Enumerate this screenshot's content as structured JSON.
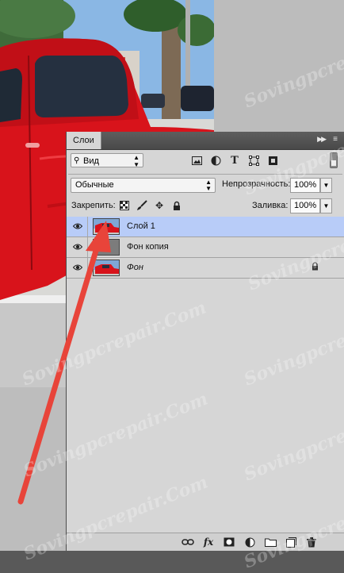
{
  "panel": {
    "tab_label": "Слои",
    "collapse_icon": "double-chevron-right-icon",
    "menu_icon": "panel-menu-icon"
  },
  "filter": {
    "kind_label": "Вид",
    "icons": [
      "image-filter-icon",
      "adjustment-filter-icon",
      "type-filter-icon",
      "shape-filter-icon",
      "smart-object-filter-icon"
    ]
  },
  "blend": {
    "mode": "Обычные",
    "opacity_label": "Непрозрачность:",
    "opacity_value": "100%"
  },
  "lock": {
    "label": "Закрепить:",
    "icons": [
      "lock-transparent-pixels-icon",
      "lock-image-pixels-icon",
      "lock-position-icon",
      "lock-all-icon"
    ],
    "fill_label": "Заливка:",
    "fill_value": "100%"
  },
  "layers": [
    {
      "name": "Слой 1",
      "active": true,
      "italic": false,
      "thumbnail": "car-photo",
      "locked": false
    },
    {
      "name": "Фон копия",
      "active": false,
      "italic": false,
      "thumbnail": "gray",
      "locked": false
    },
    {
      "name": "Фон",
      "active": false,
      "italic": true,
      "thumbnail": "car-photo",
      "locked": true
    }
  ],
  "bottom_bar": {
    "icons": [
      "link-layers-icon",
      "fx-icon",
      "add-mask-icon",
      "adjustment-layer-icon",
      "new-group-icon",
      "new-layer-icon",
      "delete-icon"
    ],
    "fx_label": "fx"
  },
  "watermark_text": "Sovingpcrepair.Com",
  "colors": {
    "accent_selection": "#b8ccf8",
    "panel_bg": "#d6d6d6",
    "header_bg": "#4f4f4f",
    "arrow": "#e8443a",
    "car_red": "#d8131b"
  }
}
